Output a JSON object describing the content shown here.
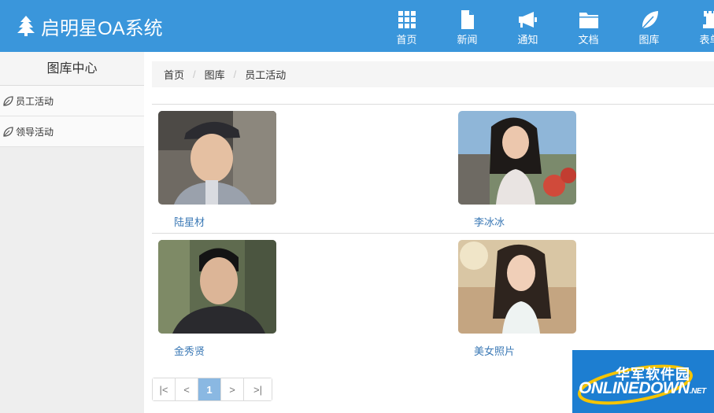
{
  "app": {
    "title": "启明星OA系统"
  },
  "nav": [
    {
      "label": "首页",
      "icon": "grid-icon"
    },
    {
      "label": "新闻",
      "icon": "document-icon"
    },
    {
      "label": "通知",
      "icon": "megaphone-icon"
    },
    {
      "label": "文档",
      "icon": "folder-icon"
    },
    {
      "label": "图库",
      "icon": "leaf-icon"
    },
    {
      "label": "表单",
      "icon": "chess-rook-icon"
    }
  ],
  "sidebar": {
    "title": "图库中心",
    "items": [
      {
        "label": "员工活动",
        "icon": "leaf-icon"
      },
      {
        "label": "领导活动",
        "icon": "leaf-icon"
      }
    ]
  },
  "breadcrumb": [
    "首页",
    "图库",
    "员工活动"
  ],
  "gallery": [
    {
      "name": "陆星材"
    },
    {
      "name": "李冰冰"
    },
    {
      "name": "金秀贤"
    },
    {
      "name": "美女照片"
    }
  ],
  "pagination": {
    "first": "|<",
    "prev": "<",
    "current": "1",
    "next": ">",
    "last": ">|"
  },
  "watermark": {
    "cn": "华军软件园",
    "en": "ONLINEDOWN",
    "suffix": ".NET"
  },
  "colors": {
    "header": "#3a96db",
    "link": "#3a78b5",
    "active_page": "#8ab8e2"
  }
}
